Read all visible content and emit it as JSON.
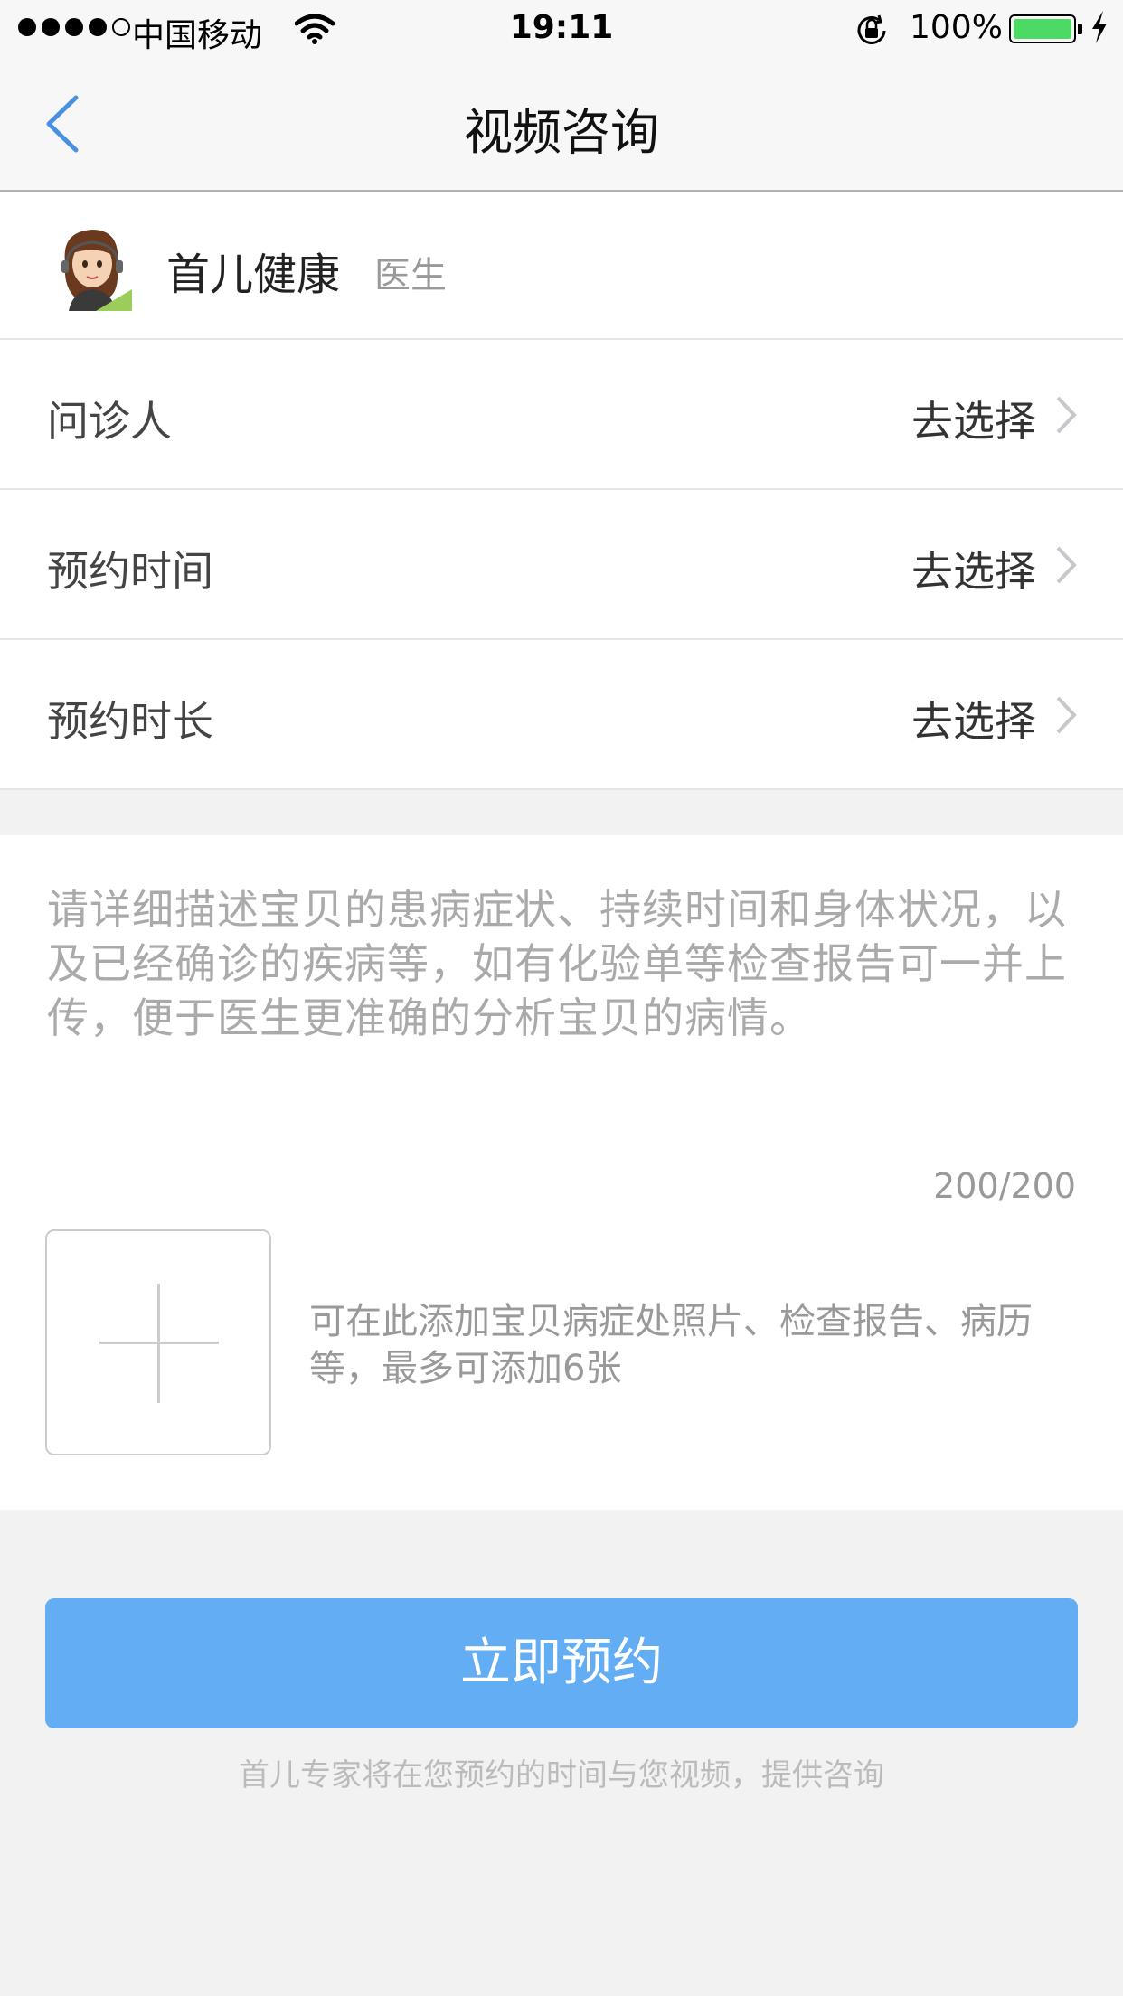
{
  "status_bar": {
    "carrier": "中国移动",
    "time": "19:11",
    "battery": "100%",
    "icons": [
      "signal-dots-icon",
      "wifi-icon",
      "rotation-lock-icon",
      "battery-icon",
      "charging-bolt-icon"
    ],
    "battery_color": "#4cd964",
    "battery_level": 1.0
  },
  "nav": {
    "title": "视频咨询",
    "back_icon": "chevron-left-icon",
    "accent": "#4a90e2"
  },
  "doctor": {
    "name": "首儿健康",
    "role": "医生",
    "avatar_icon": "doctor-avatar-icon"
  },
  "options": [
    {
      "label": "问诊人",
      "value": "去选择"
    },
    {
      "label": "预约时间",
      "value": "去选择"
    },
    {
      "label": "预约时长",
      "value": "去选择"
    }
  ],
  "description": {
    "placeholder": "请详细描述宝贝的患病症状、持续时间和身体状况，以及已经确诊的疾病等，如有化验单等检查报告可一并上传，便于医生更准确的分析宝贝的病情。",
    "counter": "200/200"
  },
  "attachments": {
    "add_icon": "plus-icon",
    "hint": "可在此添加宝贝病症处照片、检查报告、病历等，最多可添加6张"
  },
  "submit": {
    "label": "立即预约",
    "note": "首儿专家将在您预约的时间与您视频，提供咨询",
    "color": "#62adf3"
  }
}
